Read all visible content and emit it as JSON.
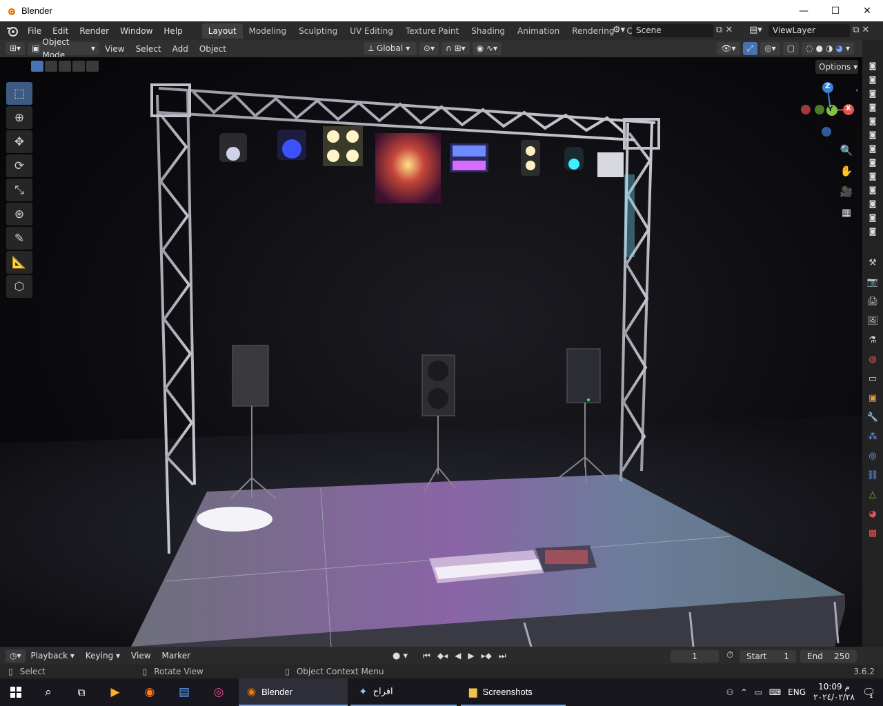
{
  "window": {
    "title": "Blender"
  },
  "window_controls": {
    "minimize": "—",
    "maximize": "☐",
    "close": "✕"
  },
  "menu": [
    "File",
    "Edit",
    "Render",
    "Window",
    "Help"
  ],
  "workspaces": [
    "Layout",
    "Modeling",
    "Sculpting",
    "UV Editing",
    "Texture Paint",
    "Shading",
    "Animation",
    "Rendering",
    "Compositing"
  ],
  "active_workspace": "Layout",
  "scene": {
    "name": "Scene"
  },
  "view_layer": {
    "name": "ViewLayer"
  },
  "header": {
    "mode": "Object Mode",
    "view": "View",
    "select": "Select",
    "add": "Add",
    "object": "Object",
    "orientation": "Global"
  },
  "viewport": {
    "options_label": "Options",
    "gizmo": {
      "z": "Z",
      "y": "Y",
      "x": "X"
    }
  },
  "toolbar_tools": [
    "select-box-icon",
    "cursor-icon",
    "move-icon",
    "rotate-icon",
    "scale-icon",
    "transform-icon",
    "annotate-icon",
    "measure-icon",
    "add-cube-icon"
  ],
  "timeline": {
    "playback": "Playback",
    "keying": "Keying",
    "view": "View",
    "marker": "Marker",
    "current_frame": "1",
    "start_label": "Start",
    "start_value": "1",
    "end_label": "End",
    "end_value": "250"
  },
  "status": {
    "select": "Select",
    "rotate_view": "Rotate View",
    "context_menu": "Object Context Menu",
    "version": "3.6.2"
  },
  "taskbar": {
    "apps": [
      {
        "label": "Blender",
        "icon": "blender-icon",
        "state": "active"
      },
      {
        "label": "افراح",
        "icon": "app-icon",
        "state": "open"
      },
      {
        "label": "Screenshots",
        "icon": "folder-icon",
        "state": "open"
      }
    ],
    "language": "ENG",
    "time": "10:09 م",
    "date": "٢٠٢٤/٠٢/٢٨",
    "notification_count": "1"
  },
  "colors": {
    "accent": "#4772b3",
    "header_bg": "#303030",
    "topbar_bg": "#2b2b2b",
    "gizmo_x": "#e05353",
    "gizmo_y": "#7fc342",
    "gizmo_z": "#3b82d6"
  }
}
